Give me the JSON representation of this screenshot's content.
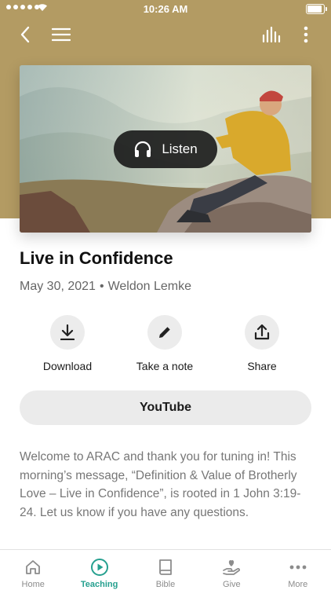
{
  "status_bar": {
    "time": "10:26 AM"
  },
  "media": {
    "listen_label": "Listen",
    "title": "Live in Confidence",
    "date": "May 30, 2021",
    "separator": "•",
    "speaker": "Weldon Lemke"
  },
  "actions": [
    {
      "label": "Download",
      "icon": "download-icon"
    },
    {
      "label": "Take a note",
      "icon": "pencil-icon"
    },
    {
      "label": "Share",
      "icon": "share-icon"
    }
  ],
  "youtube_label": "YouTube",
  "description": "Welcome to ARAC and thank you for tuning in! This morning’s message, “Definition & Value of Brotherly Love – Live in Confidence”, is rooted in 1 John 3:19-24. Let us know if you have any questions.",
  "tabs": [
    {
      "label": "Home",
      "icon": "home-icon",
      "active": false
    },
    {
      "label": "Teaching",
      "icon": "play-circle-icon",
      "active": true
    },
    {
      "label": "Bible",
      "icon": "book-icon",
      "active": false
    },
    {
      "label": "Give",
      "icon": "give-hand-heart-icon",
      "active": false
    },
    {
      "label": "More",
      "icon": "more-dots-icon",
      "active": false
    }
  ],
  "colors": {
    "header_background": "#b39b63",
    "accent": "#26a08f",
    "inactive_tab": "#8c8c8c"
  }
}
